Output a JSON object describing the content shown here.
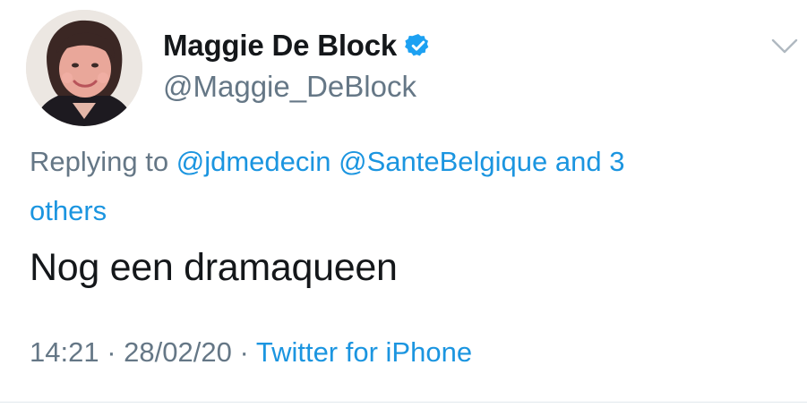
{
  "tweet": {
    "display_name": "Maggie De Block",
    "handle": "@Maggie_DeBlock",
    "verified": true,
    "reply": {
      "prefix": "Replying to",
      "mention_1": "@jdmedecin",
      "mention_2": "@SanteBelgique",
      "and_others_part1": "and 3",
      "and_others_part2": "others"
    },
    "text": "Nog een dramaqueen",
    "time": "14:21",
    "separator": "·",
    "date": "28/02/20",
    "source": "Twitter for iPhone"
  },
  "icons": {
    "avatar": "profile-photo",
    "verified": "verified-badge-icon",
    "menu": "chevron-down-icon"
  },
  "colors": {
    "name": "#14171a",
    "secondary": "#657786",
    "link": "#1b95e0",
    "verified": "#1da1f2",
    "divider": "#e1e8ed"
  }
}
